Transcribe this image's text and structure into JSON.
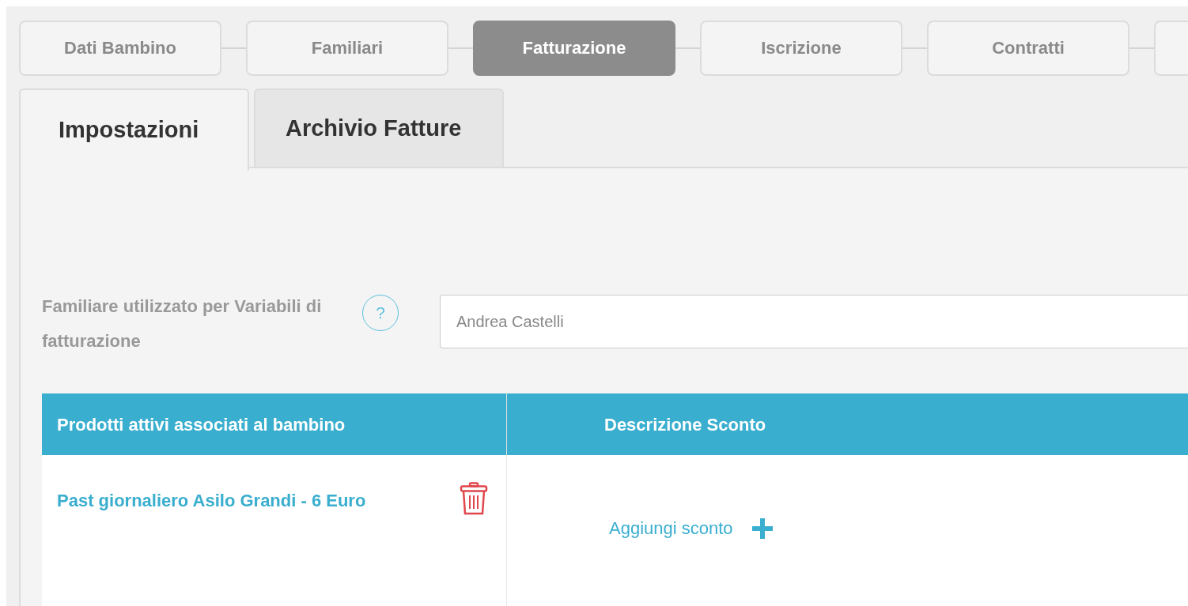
{
  "steps": [
    {
      "label": "Dati Bambino",
      "selected": false
    },
    {
      "label": "Familiari",
      "selected": false
    },
    {
      "label": "Fatturazione",
      "selected": true
    },
    {
      "label": "Iscrizione",
      "selected": false
    },
    {
      "label": "Contratti",
      "selected": false
    },
    {
      "selected": false
    }
  ],
  "tabs": [
    {
      "label": "Impostazioni",
      "selected": true
    },
    {
      "label": "Archivio Fatture",
      "selected": false
    }
  ],
  "billing_member": {
    "label": "Familiare utilizzato per Variabili di fatturazione",
    "help": "?",
    "value": "Andrea Castelli"
  },
  "table": {
    "columns": [
      "Prodotti attivi associati al bambino",
      "Descrizione Sconto"
    ],
    "rows": [
      {
        "product": "Past giornaliero Asilo Grandi - 6 Euro",
        "action": "Aggiungi sconto"
      }
    ]
  }
}
